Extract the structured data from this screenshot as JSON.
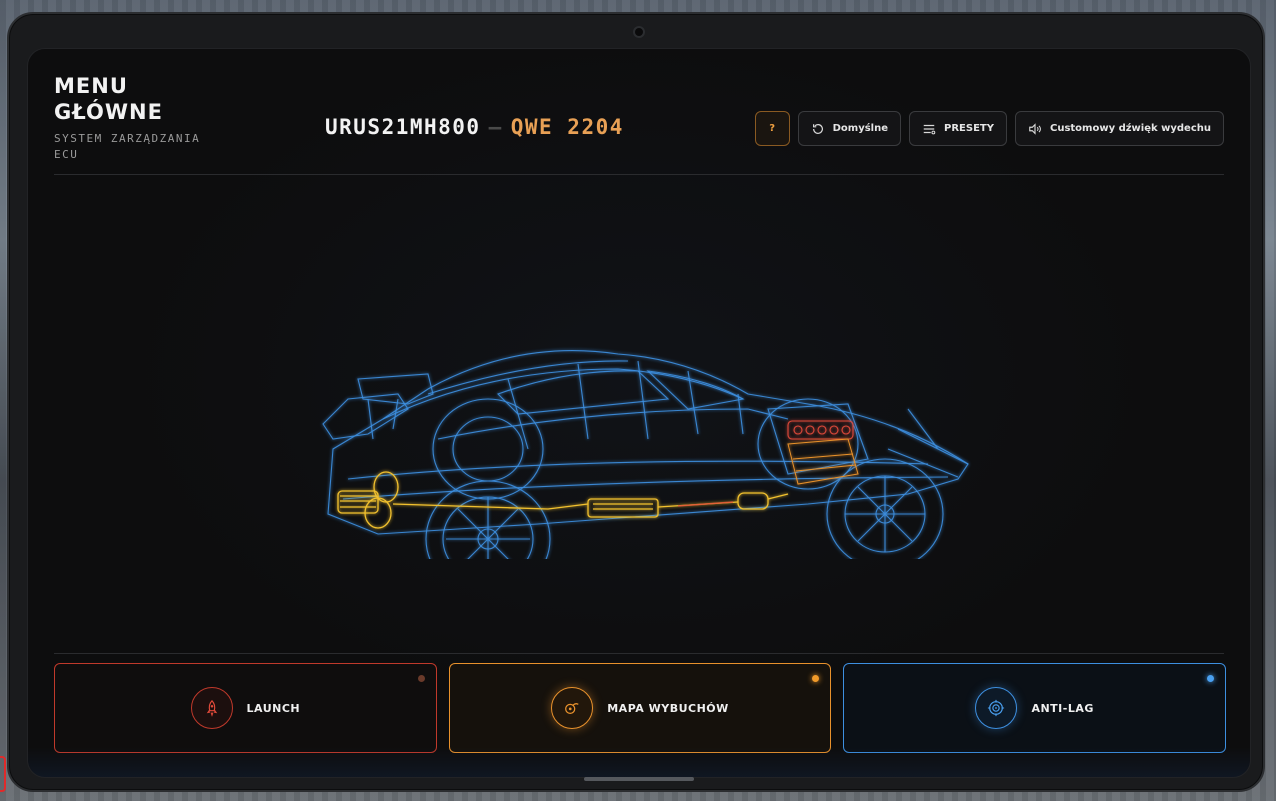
{
  "header": {
    "title": "MENU GŁÓWNE",
    "subtitle": "SYSTEM ZARZĄDZANIA ECU",
    "plate": "URUS21MH800",
    "separator": "—",
    "model": "QWE 2204"
  },
  "toolbar": {
    "help_label": "?",
    "default_label": "Domyślne",
    "presets_label": "PRESETY",
    "exhaust_label": "Customowy dźwięk wydechu"
  },
  "modes": [
    {
      "label": "LAUNCH",
      "icon": "rocket-icon",
      "color": "#c0392b"
    },
    {
      "label": "MAPA WYBUCHÓW",
      "icon": "turbo-icon",
      "color": "#e8912c"
    },
    {
      "label": "ANTI-LAG",
      "icon": "target-icon",
      "color": "#3d8fe0"
    }
  ],
  "colors": {
    "accent_orange": "#e8a055",
    "wireframe_blue": "#3d8fe0",
    "exhaust_yellow": "#f2c12e",
    "engine_red": "#e04a3a"
  }
}
